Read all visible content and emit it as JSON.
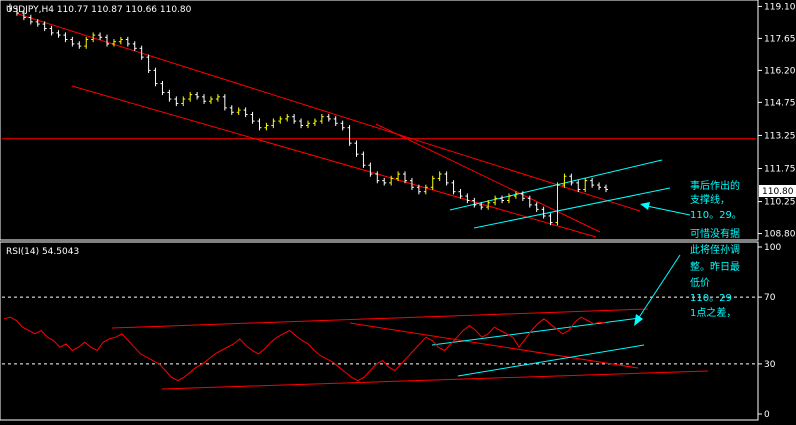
{
  "header": {
    "symbol_info": "USDJPY,H4  110.77 110.87 110.66 110.80",
    "rsi_label": "RSI(14) 54.5043"
  },
  "annotation": {
    "lines": [
      "事后作出的",
      "支撑线，",
      "110。29。",
      "可惜没有据",
      "此将侄孙调",
      "整。昨日最",
      "低价",
      "110。29",
      "1点之差，"
    ]
  },
  "colors": {
    "background": "#000000",
    "axis": "#ffffff",
    "bull": "#ffff00",
    "bear": "#ffffff",
    "trend_lines": "#ff0000",
    "channel_lines": "#00ffff",
    "annotation_text": "#00ffff",
    "rsi_line": "#ff0000",
    "level_lines": "#ffffff",
    "price_tag_bg": "#ffffff",
    "price_tag_text": "#000000"
  },
  "chart_data": [
    {
      "type": "candlestick",
      "title": "USDJPY,H4",
      "ohlc_last": {
        "open": 110.77,
        "high": 110.87,
        "low": 110.66,
        "close": 110.8
      },
      "y_ticks": [
        "119.10",
        "117.65",
        "116.20",
        "114.75",
        "113.25",
        "111.75",
        "110.25",
        "108.80"
      ],
      "ylim": [
        108.6,
        119.3
      ],
      "current_price": "110.80",
      "horizontal_level": 113.1,
      "series": [
        {
          "values": [
            119.0,
            118.8,
            118.6,
            118.4,
            118.3,
            118.1,
            117.9,
            117.8,
            117.6,
            117.4,
            117.3,
            117.6,
            117.8,
            117.7,
            117.4,
            117.5,
            117.6,
            117.4,
            117.2,
            116.8,
            116.2,
            115.6,
            115.2,
            114.9,
            114.7,
            114.9,
            115.1,
            115.0,
            114.8,
            114.9,
            115.0,
            114.5,
            114.3,
            114.4,
            114.2,
            113.9,
            113.6,
            113.7,
            113.9,
            114.0,
            114.1,
            113.9,
            113.7,
            113.8,
            113.9,
            114.1,
            114.0,
            113.8,
            113.6,
            112.9,
            112.4,
            111.9,
            111.5,
            111.2,
            111.1,
            111.3,
            111.5,
            111.2,
            110.9,
            110.7,
            110.9,
            111.3,
            111.5,
            111.1,
            110.7,
            110.5,
            110.3,
            110.1,
            110.0,
            110.2,
            110.4,
            110.3,
            110.5,
            110.6,
            110.4,
            110.1,
            109.9,
            109.6,
            109.3,
            111.0,
            111.4,
            111.1,
            110.8,
            111.2,
            111.0,
            110.9,
            110.8
          ]
        }
      ]
    },
    {
      "type": "line",
      "title": "RSI(14)",
      "value_label": "54.5043",
      "y_ticks": [
        "100",
        "70",
        "30",
        "0"
      ],
      "ylim": [
        0,
        100
      ],
      "levels": [
        70,
        30
      ],
      "series": [
        {
          "name": "RSI(14)",
          "values": [
            57,
            58,
            56,
            52,
            50,
            48,
            50,
            46,
            44,
            40,
            42,
            38,
            40,
            43,
            40,
            38,
            43,
            45,
            46,
            48,
            44,
            40,
            36,
            34,
            32,
            30,
            26,
            22,
            20,
            22,
            25,
            28,
            30,
            33,
            36,
            38,
            40,
            42,
            45,
            41,
            38,
            36,
            39,
            43,
            46,
            48,
            50,
            47,
            44,
            42,
            38,
            35,
            33,
            31,
            28,
            25,
            22,
            20,
            22,
            26,
            30,
            32,
            28,
            26,
            30,
            34,
            38,
            42,
            46,
            44,
            40,
            38,
            42,
            46,
            50,
            53,
            50,
            46,
            48,
            52,
            50,
            48,
            46,
            40,
            45,
            50,
            54,
            57,
            54,
            51,
            48,
            50,
            55,
            58,
            56,
            54,
            55,
            54.5043
          ]
        }
      ]
    }
  ]
}
